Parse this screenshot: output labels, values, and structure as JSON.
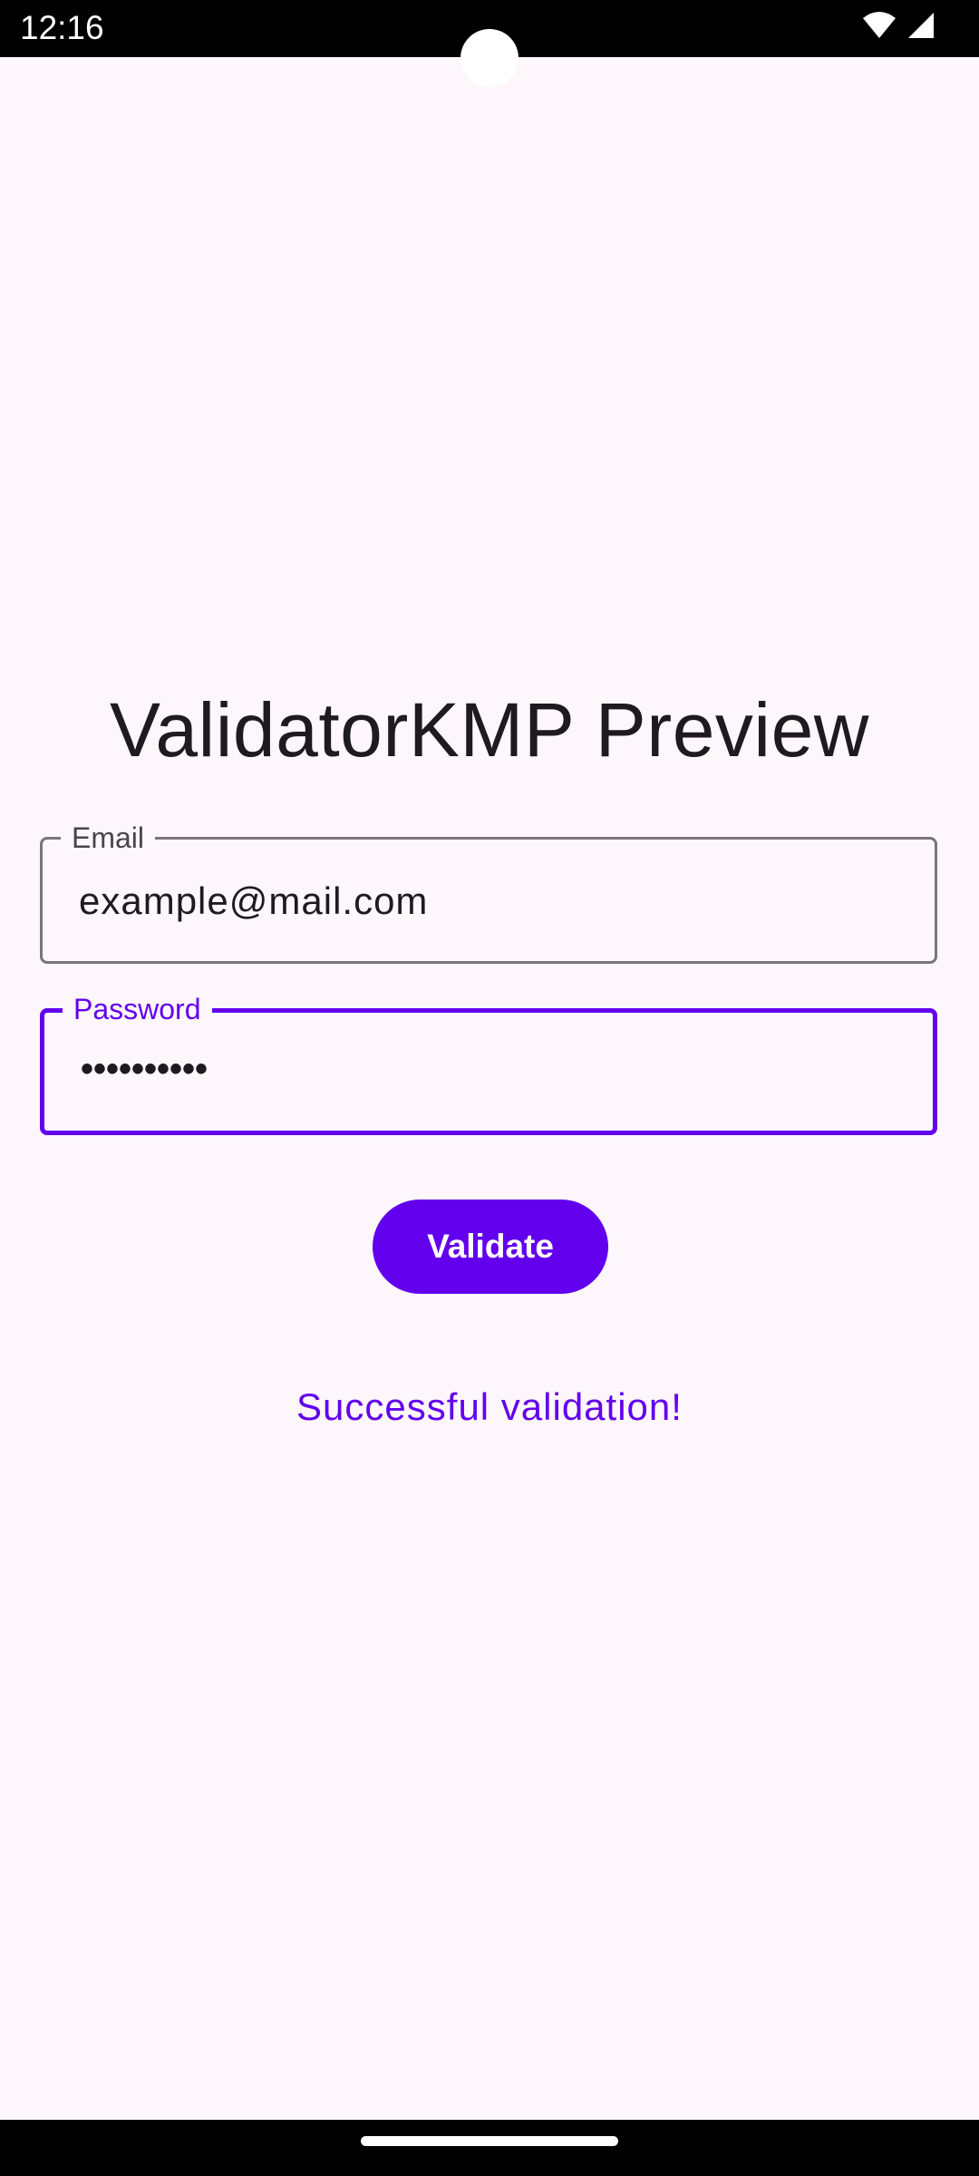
{
  "status_bar": {
    "time": "12:16",
    "icons": [
      "wifi-icon",
      "cellular-signal-icon"
    ]
  },
  "app": {
    "title": "ValidatorKMP Preview"
  },
  "form": {
    "email": {
      "label": "Email",
      "value": "example@mail.com"
    },
    "password": {
      "label": "Password",
      "value": "••••••••••",
      "focused": true
    },
    "validate_label": "Validate",
    "result": "Successful validation!"
  },
  "colors": {
    "accent": "#6200ee",
    "background": "#fdf7fb",
    "text": "#1d1b20",
    "outline": "#79747e"
  }
}
